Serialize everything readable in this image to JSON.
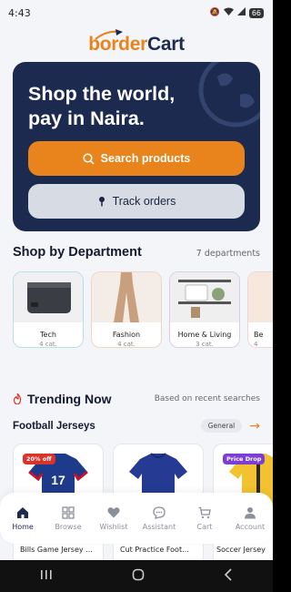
{
  "status_bar": {
    "time": "4:43",
    "battery": "66"
  },
  "logo": {
    "prefix": "b",
    "order": "order",
    "cart": "Cart"
  },
  "hero": {
    "title_line1": "Shop the world,",
    "title_line2": "pay in Naira.",
    "search_label": "Search products",
    "track_label": "Track orders"
  },
  "departments": {
    "title": "Shop by Department",
    "count_label": "7 departments",
    "items": [
      {
        "name": "Tech",
        "count": "4 cat."
      },
      {
        "name": "Fashion",
        "count": "4 cat."
      },
      {
        "name": "Home & Living",
        "count": "3 cat."
      },
      {
        "name": "Be",
        "count": "4"
      }
    ]
  },
  "trending": {
    "title": "Trending Now",
    "subtitle": "Based on recent searches",
    "category_title": "Football Jerseys",
    "chip": "General",
    "products": [
      {
        "name": "Bills Game Jersey ...",
        "badge": "20% off"
      },
      {
        "name": "Cut Practice Foot...",
        "badge": ""
      },
      {
        "name": "Soccer Jersey",
        "badge": "Price Drop"
      }
    ]
  },
  "bottom_nav": {
    "items": [
      {
        "label": "Home"
      },
      {
        "label": "Browse"
      },
      {
        "label": "Wishlist"
      },
      {
        "label": "Assistant"
      },
      {
        "label": "Cart"
      },
      {
        "label": "Account"
      }
    ]
  },
  "colors": {
    "brand_orange": "#e8841b",
    "brand_navy": "#1b2a4e",
    "background": "#f4f5f9"
  }
}
